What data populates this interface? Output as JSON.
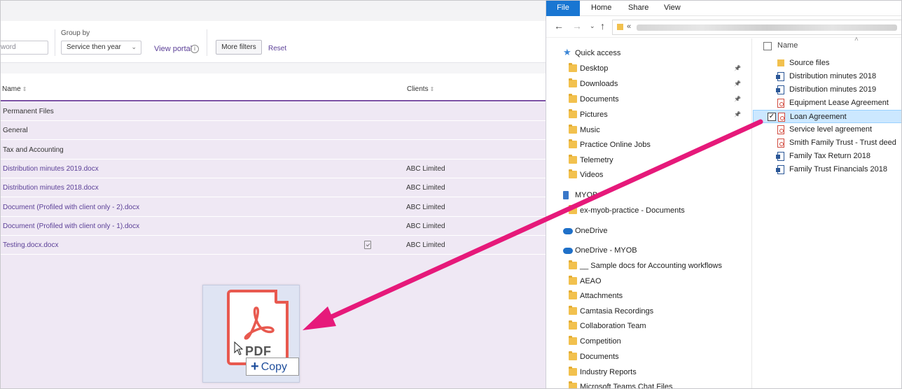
{
  "web": {
    "keyword_placeholder": "word",
    "group_by_label": "Group by",
    "group_by_value": "Service then year",
    "view_portal": "View portal",
    "more_filters": "More filters",
    "reset": "Reset",
    "columns": {
      "name": "Name",
      "clients": "Clients"
    },
    "rows": [
      {
        "name": "Permanent Files",
        "kind": "group",
        "client": ""
      },
      {
        "name": "General",
        "kind": "group",
        "client": ""
      },
      {
        "name": "Tax and Accounting",
        "kind": "group",
        "client": ""
      },
      {
        "name": "Distribution minutes 2019.docx",
        "kind": "file",
        "client": "ABC Limited"
      },
      {
        "name": "Distribution minutes 2018.docx",
        "kind": "file",
        "client": "ABC Limited"
      },
      {
        "name": "Document (Profiled with client only - 2).docx",
        "kind": "file",
        "client": "ABC Limited"
      },
      {
        "name": "Document (Profiled with client only - 1).docx",
        "kind": "file",
        "client": "ABC Limited"
      },
      {
        "name": "Testing.docx.docx",
        "kind": "file",
        "client": "ABC Limited",
        "has_check_icon": true
      }
    ],
    "drag": {
      "pdf_label": "PDF",
      "copy_label": "Copy"
    }
  },
  "explorer": {
    "ribbon_tabs": [
      "File",
      "Home",
      "Share",
      "View"
    ],
    "address_prefix": "«",
    "nav_items": [
      {
        "label": "Quick access",
        "icon": "star-icon",
        "indent": 0
      },
      {
        "label": "Desktop",
        "icon": "folder-icon",
        "indent": 1,
        "pinned": true
      },
      {
        "label": "Downloads",
        "icon": "folder-icon",
        "indent": 1,
        "pinned": true
      },
      {
        "label": "Documents",
        "icon": "folder-icon",
        "indent": 1,
        "pinned": true
      },
      {
        "label": "Pictures",
        "icon": "folder-icon",
        "indent": 1,
        "pinned": true
      },
      {
        "label": "Music",
        "icon": "folder-icon",
        "indent": 1
      },
      {
        "label": "Practice Online Jobs",
        "icon": "folder-icon",
        "indent": 1
      },
      {
        "label": "Telemetry",
        "icon": "folder-icon",
        "indent": 1
      },
      {
        "label": "Videos",
        "icon": "folder-icon",
        "indent": 1
      },
      {
        "label": "MYOB",
        "icon": "building-icon",
        "indent": 0
      },
      {
        "label": "ex-myob-practice - Documents",
        "icon": "folder-icon",
        "indent": 1
      },
      {
        "label": "OneDrive",
        "icon": "cloud-icon",
        "indent": 0
      },
      {
        "label": "OneDrive - MYOB",
        "icon": "cloud-icon",
        "indent": 0
      },
      {
        "label": "__ Sample docs for Accounting workflows",
        "icon": "folder-icon",
        "indent": 1
      },
      {
        "label": "AEAO",
        "icon": "folder-icon",
        "indent": 1
      },
      {
        "label": "Attachments",
        "icon": "folder-icon",
        "indent": 1
      },
      {
        "label": "Camtasia Recordings",
        "icon": "folder-icon",
        "indent": 1
      },
      {
        "label": "Collaboration Team",
        "icon": "folder-icon",
        "indent": 1
      },
      {
        "label": "Competition",
        "icon": "folder-icon",
        "indent": 1
      },
      {
        "label": "Documents",
        "icon": "folder-icon",
        "indent": 1
      },
      {
        "label": "Industry Reports",
        "icon": "folder-icon",
        "indent": 1
      },
      {
        "label": "Microsoft Teams Chat Files",
        "icon": "folder-icon",
        "indent": 1
      }
    ],
    "file_header": "Name",
    "files": [
      {
        "label": "Source files",
        "type": "folder"
      },
      {
        "label": "Distribution minutes 2018",
        "type": "word"
      },
      {
        "label": "Distribution minutes 2019",
        "type": "word"
      },
      {
        "label": "Equipment Lease Agreement",
        "type": "pdf"
      },
      {
        "label": "Loan Agreement",
        "type": "pdf",
        "selected": true
      },
      {
        "label": "Service level agreement",
        "type": "pdf"
      },
      {
        "label": "Smith Family Trust - Trust deed",
        "type": "pdf"
      },
      {
        "label": "Family Tax Return 2018",
        "type": "word"
      },
      {
        "label": "Family Trust Financials 2018",
        "type": "word"
      }
    ]
  },
  "colors": {
    "accent_purple": "#5b3f97",
    "row_bg": "#efe8f4",
    "explorer_blue": "#1976d2",
    "arrow_pink": "#e6197a"
  }
}
